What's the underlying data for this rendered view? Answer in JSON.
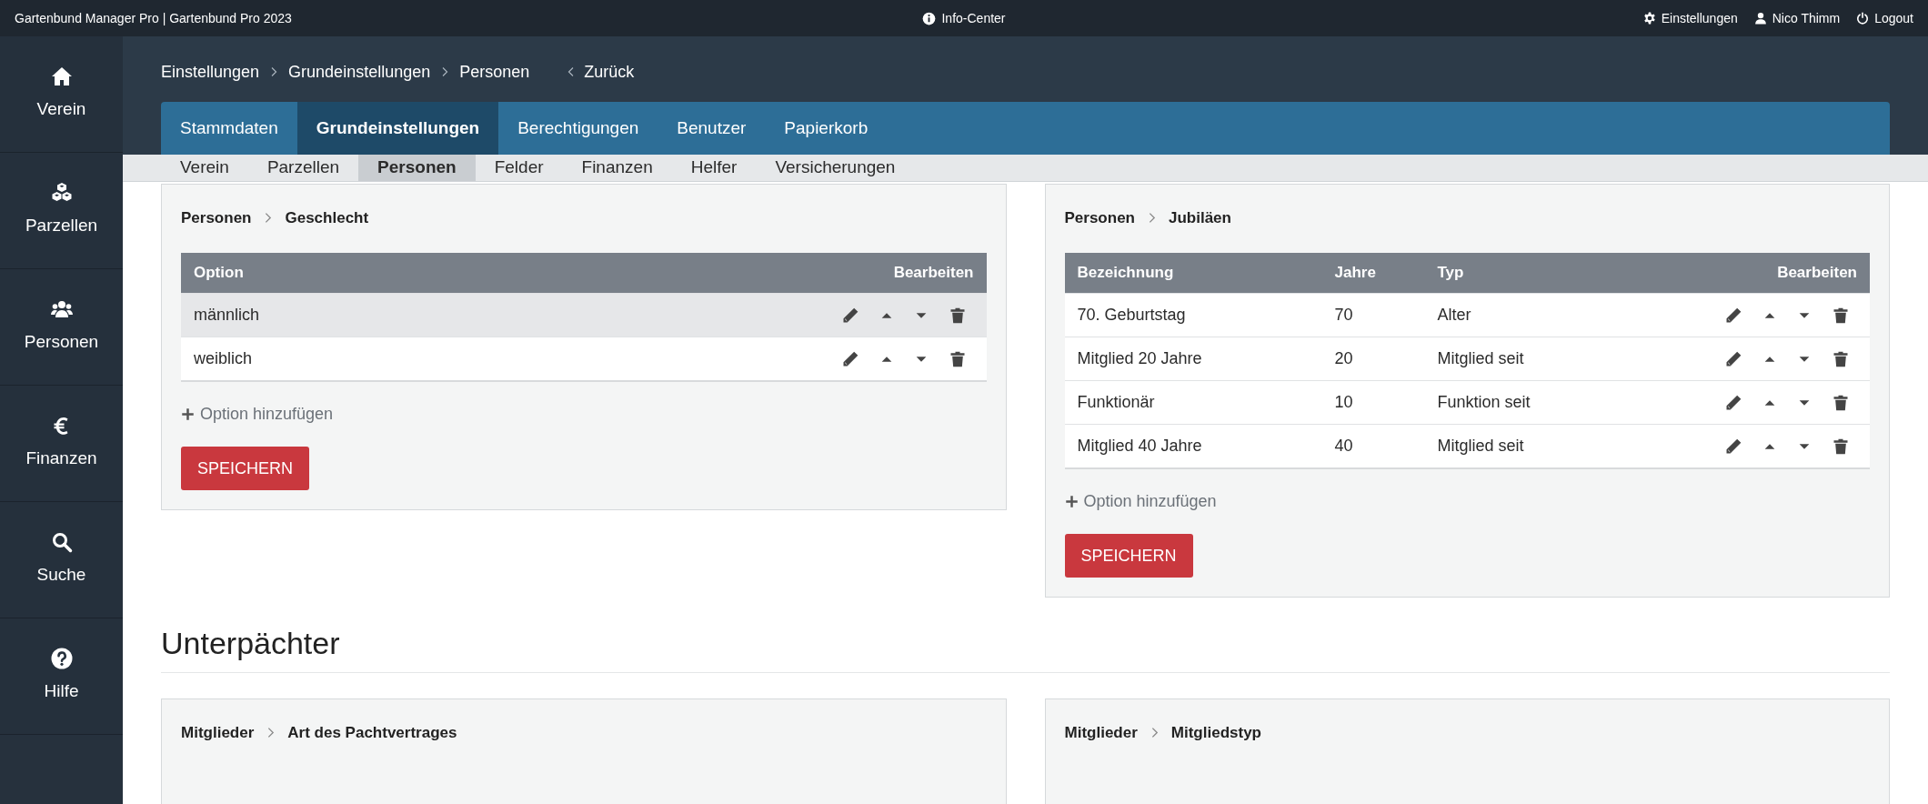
{
  "top_bar": {
    "title": "Gartenbund Manager Pro | Gartenbund Pro 2023",
    "center": {
      "kind": "info",
      "label": "Info-Center"
    },
    "links": [
      {
        "kind": "settings",
        "label": "Einstellungen"
      },
      {
        "kind": "user",
        "label": "Nico Thimm"
      },
      {
        "kind": "logout",
        "label": "Logout"
      }
    ]
  },
  "sidebar": {
    "items": [
      {
        "kind": "home",
        "label": "Verein"
      },
      {
        "kind": "cubes",
        "label": "Parzellen"
      },
      {
        "kind": "users",
        "label": "Personen"
      },
      {
        "kind": "euro",
        "label": "Finanzen"
      },
      {
        "kind": "search",
        "label": "Suche"
      },
      {
        "kind": "help",
        "label": "Hilfe"
      }
    ]
  },
  "breadcrumb": {
    "items": [
      "Einstellungen",
      "Grundeinstellungen",
      "Personen"
    ],
    "back": "Zurück"
  },
  "tabs": [
    {
      "label": "Stammdaten",
      "selected": false
    },
    {
      "label": "Grundeinstellungen",
      "selected": true
    },
    {
      "label": "Berechtigungen",
      "selected": false
    },
    {
      "label": "Benutzer",
      "selected": false
    },
    {
      "label": "Papierkorb",
      "selected": false
    }
  ],
  "subtabs": [
    {
      "label": "Verein",
      "selected": false
    },
    {
      "label": "Parzellen",
      "selected": false
    },
    {
      "label": "Personen",
      "selected": true
    },
    {
      "label": "Felder",
      "selected": false
    },
    {
      "label": "Finanzen",
      "selected": false
    },
    {
      "label": "Helfer",
      "selected": false
    },
    {
      "label": "Versicherungen",
      "selected": false
    }
  ],
  "panels": [
    {
      "path": [
        "Personen",
        "Geschlecht"
      ],
      "columns": [
        "Option",
        "Bearbeiten"
      ],
      "rows": [
        {
          "cells": [
            "männlich"
          ],
          "highlighted": true
        },
        {
          "cells": [
            "weiblich"
          ],
          "highlighted": false
        }
      ],
      "add_label": "Option hinzufügen",
      "save_label": "SPEICHERN"
    },
    {
      "path": [
        "Personen",
        "Jubiläen"
      ],
      "columns": [
        "Bezeichnung",
        "Jahre",
        "Typ",
        "Bearbeiten"
      ],
      "rows": [
        {
          "cells": [
            "70. Geburtstag",
            "70",
            "Alter"
          ],
          "highlighted": false
        },
        {
          "cells": [
            "Mitglied 20 Jahre",
            "20",
            "Mitglied seit"
          ],
          "highlighted": false
        },
        {
          "cells": [
            "Funktionär",
            "10",
            "Funktion seit"
          ],
          "highlighted": false
        },
        {
          "cells": [
            "Mitglied 40 Jahre",
            "40",
            "Mitglied seit"
          ],
          "highlighted": false
        }
      ],
      "add_label": "Option hinzufügen",
      "save_label": "SPEICHERN"
    }
  ],
  "section": {
    "title": "Unterpächter",
    "panels": [
      {
        "path": [
          "Mitglieder",
          "Art des Pachtvertrages"
        ]
      },
      {
        "path": [
          "Mitglieder",
          "Mitgliedstyp"
        ]
      }
    ]
  }
}
